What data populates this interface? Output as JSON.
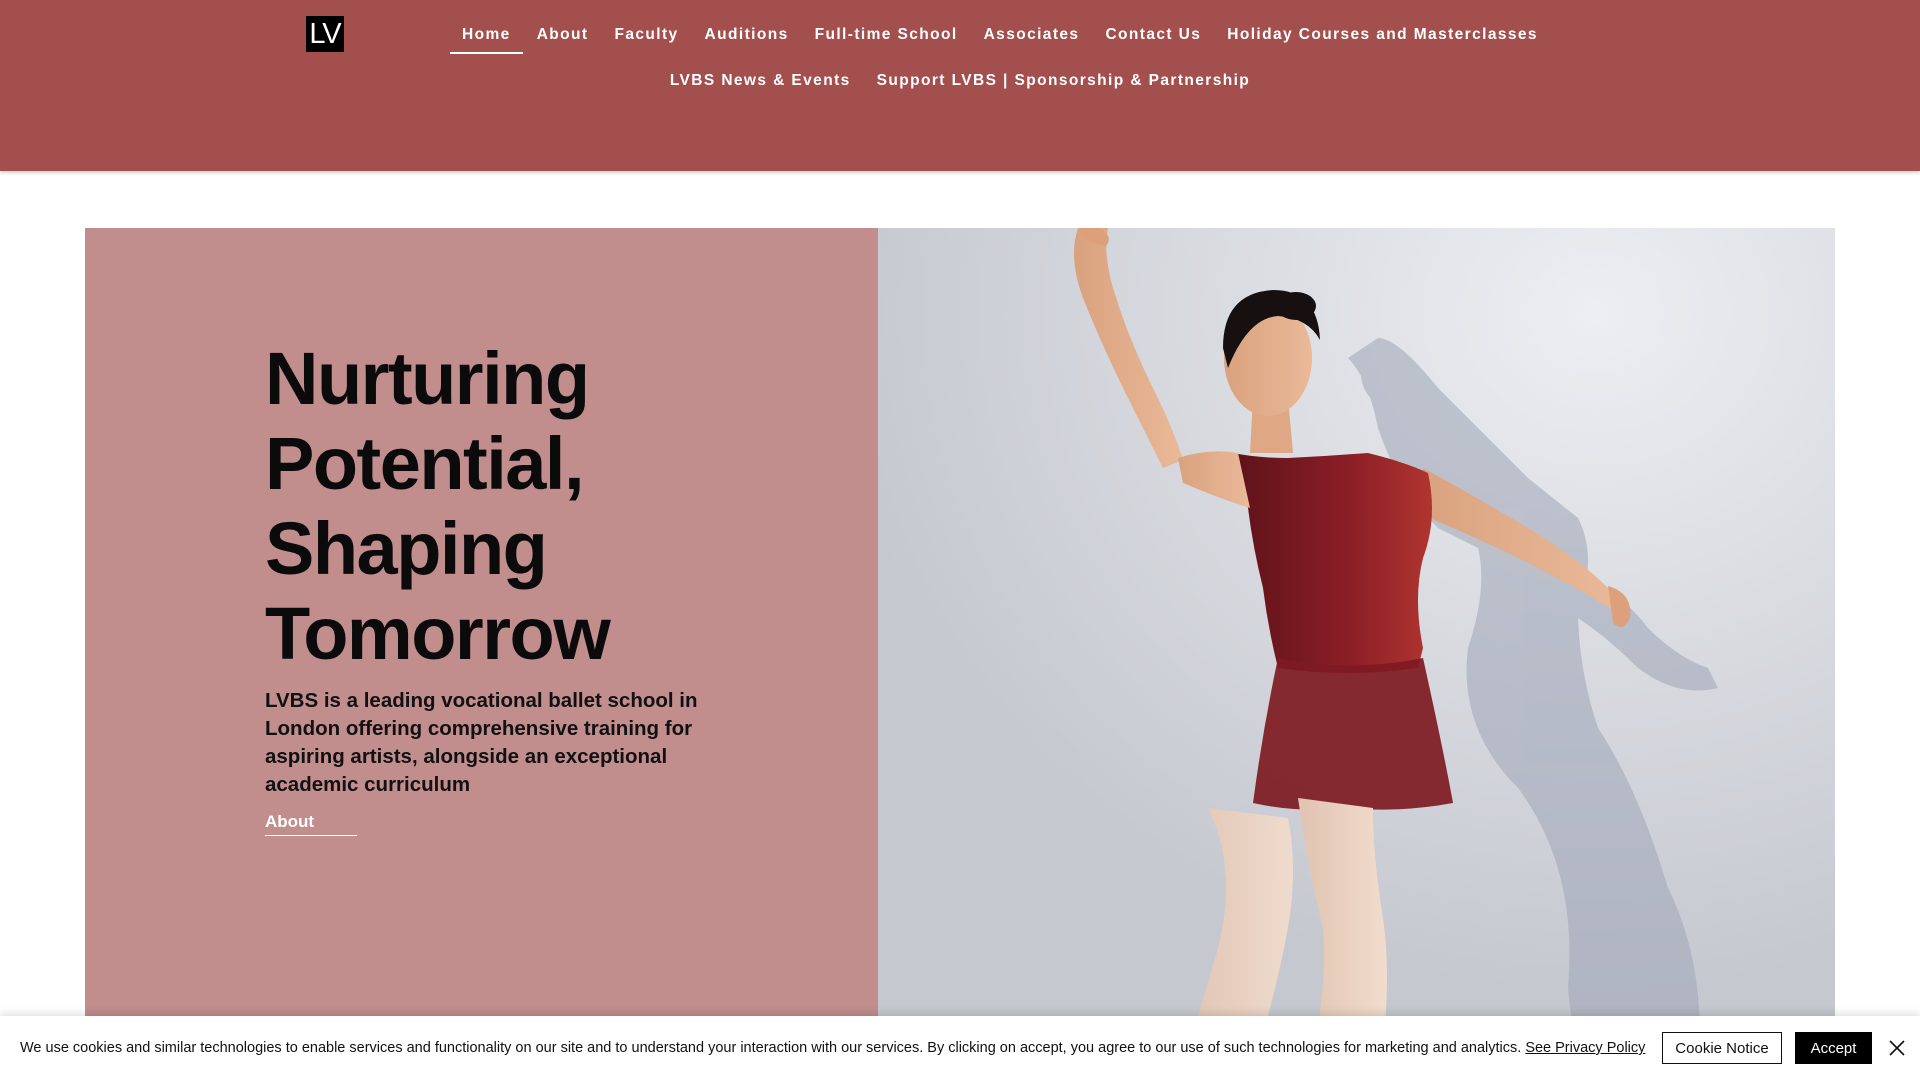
{
  "header": {
    "logo_text": "LV",
    "nav_row1": [
      "Home",
      "About",
      "Faculty",
      "Auditions",
      "Full-time School",
      "Associates",
      "Contact Us",
      "Holiday Courses and Masterclasses"
    ],
    "nav_row2": [
      "LVBS News & Events",
      "Support LVBS | Sponsorship & Partnership"
    ],
    "active_item": "Home",
    "bg_color": "#a34f4e"
  },
  "hero": {
    "title_lines": [
      "Nurturing",
      "Potential,",
      "Shaping",
      "Tomorrow"
    ],
    "description": "LVBS is a leading vocational ballet school in London offering comprehensive training for aspiring artists, alongside an exceptional academic curriculum",
    "link_label": "About",
    "panel_color": "#c18d8d",
    "image_subject": "ballet dancer in burgundy leotard and skirt"
  },
  "cookie": {
    "text": "We use cookies and similar technologies to enable services and functionality on our site and to understand your interaction with our services. By clicking on accept, you agree to our use of such technologies for marketing and analytics.",
    "policy_link": "See Privacy Policy",
    "notice_button": "Cookie Notice",
    "accept_button": "Accept",
    "close_icon": "close-icon"
  }
}
